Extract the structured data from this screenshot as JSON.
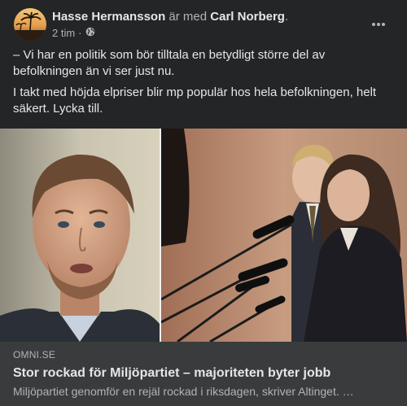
{
  "post": {
    "author": "Hasse Hermansson",
    "with_text": "är med",
    "tagged": "Carl Norberg",
    "period": ".",
    "time": "2 tim",
    "separator": "·",
    "privacy_icon": "globe-icon",
    "paragraphs": [
      "– Vi har en politik som bör tilltala en betydligt större del av befolkningen än vi ser just nu.",
      "I takt med höjda elpriser blir mp populär hos hela befolkningen, helt säkert. Lycka till."
    ]
  },
  "link": {
    "domain": "OMNI.SE",
    "title": "Stor rockad för Miljöpartiet – majoriteten byter jobb",
    "description": "Miljöpartiet genomför en rejäl rockad i riksdagen, skriver Altinget. …"
  },
  "colors": {
    "card_bg": "#242526",
    "link_box_bg": "#3a3b3c",
    "primary_text": "#e4e6eb",
    "secondary_text": "#b0b3b8"
  }
}
